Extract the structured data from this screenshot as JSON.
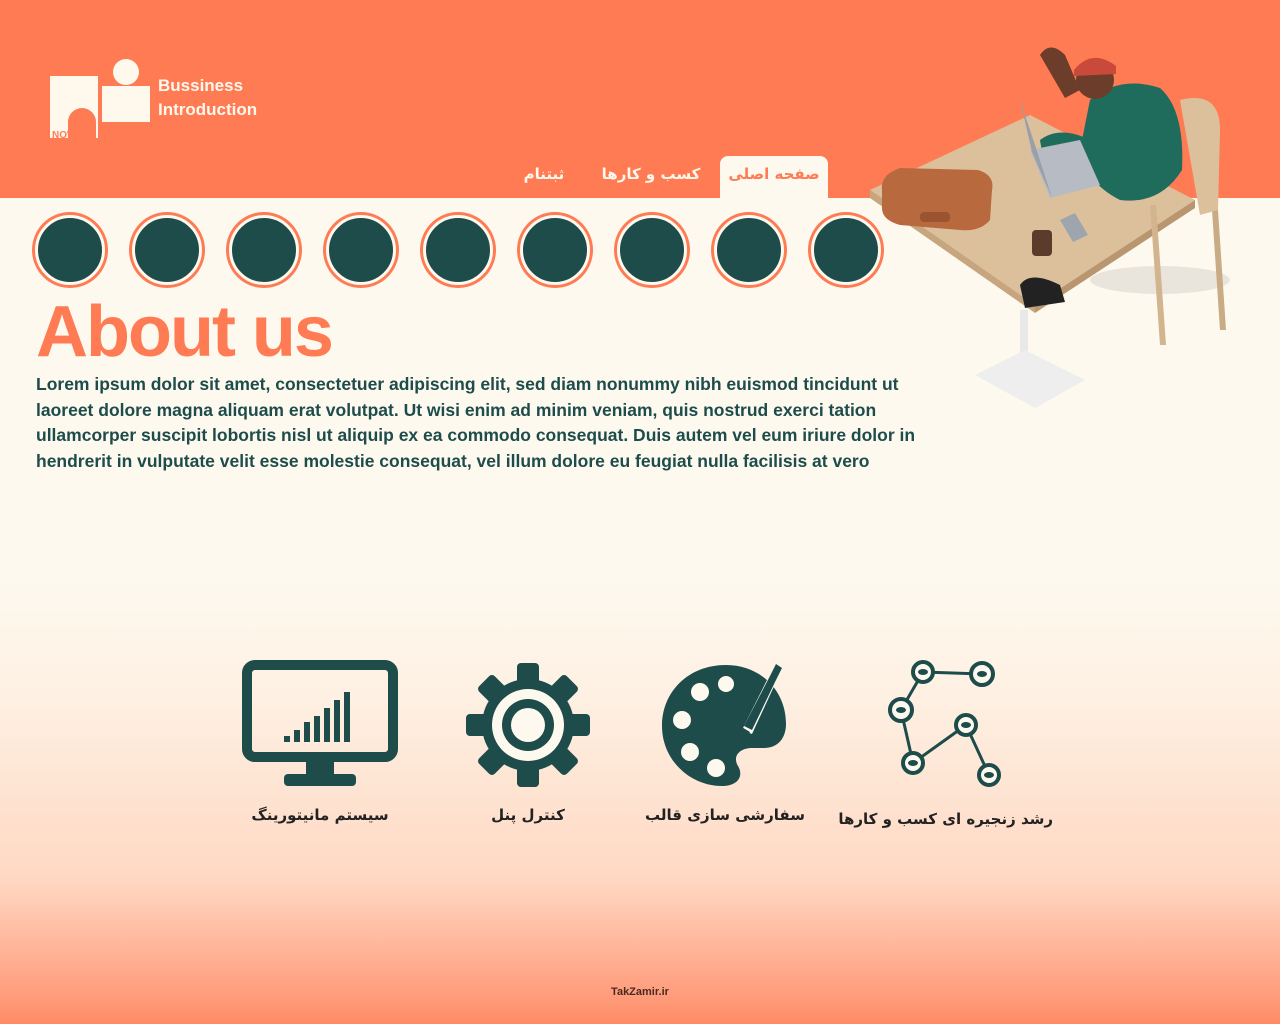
{
  "brand": {
    "line1": "Bussiness",
    "line2": "Introduction",
    "logo_text": "NOW"
  },
  "nav": {
    "tabs": [
      {
        "label": "صفحه اصلی",
        "active": true
      },
      {
        "label": "کسب و کارها",
        "active": false
      },
      {
        "label": "ثبتنام",
        "active": false
      }
    ]
  },
  "avatars": {
    "count": 9
  },
  "about": {
    "title": "About us",
    "body": "Lorem ipsum dolor sit amet, consectetuer adipiscing elit, sed diam nonummy nibh euismod tincidunt ut laoreet dolore magna aliquam erat volutpat. Ut wisi enim ad minim veniam, quis nostrud exerci tation ullamcorper suscipit lobortis nisl ut aliquip ex ea commodo consequat. Duis autem vel eum iriure dolor in hendrerit in vulputate velit esse molestie consequat, vel illum dolore eu feugiat nulla facilisis at vero"
  },
  "features": [
    {
      "label": "سیستم مانیتورینگ",
      "icon": "monitor-chart-icon"
    },
    {
      "label": "کنترل پنل",
      "icon": "gear-icon"
    },
    {
      "label": "سفارشی سازی قالب",
      "icon": "palette-icon"
    },
    {
      "label": "رشد زنجیره ای کسب و کارها",
      "icon": "network-graph-icon"
    }
  ],
  "footer": {
    "text": "TakZamir.ir"
  },
  "colors": {
    "accent": "#ff7b54",
    "dark": "#1d4c4b",
    "background": "#fdf9ef"
  }
}
